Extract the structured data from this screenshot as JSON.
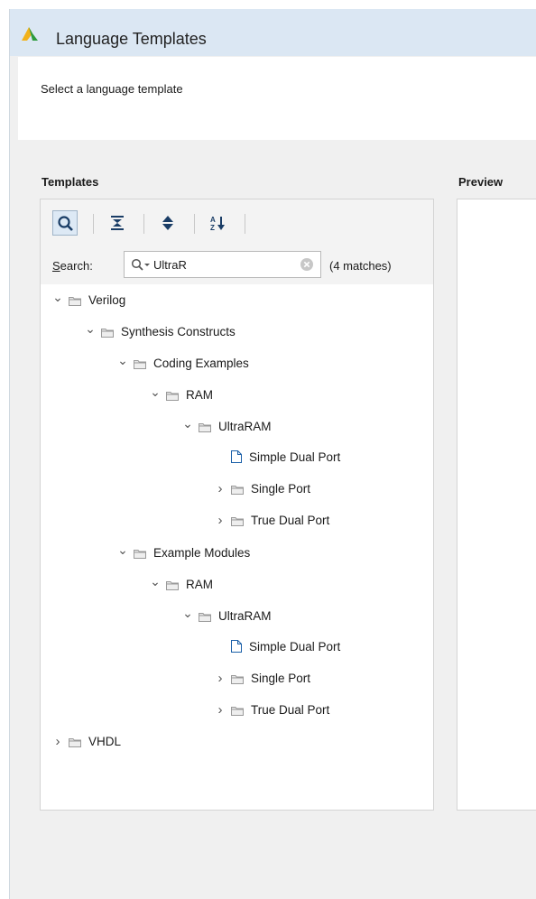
{
  "window": {
    "title": "Language Templates"
  },
  "header": {
    "subtitle": "Select a language template"
  },
  "templates": {
    "label": "Templates"
  },
  "preview": {
    "label": "Preview"
  },
  "toolbar": {
    "buttons": [
      "search-icon",
      "collapse-all-icon",
      "expand-icon",
      "sort-icon"
    ]
  },
  "search": {
    "label_prefix": "S",
    "label_rest": "earch:",
    "value": "UltraR",
    "match_count": "(4 matches)"
  },
  "tree": [
    {
      "label": "Verilog",
      "level": 0,
      "expanded": true,
      "type": "folder"
    },
    {
      "label": "Synthesis Constructs",
      "level": 1,
      "expanded": true,
      "type": "folder"
    },
    {
      "label": "Coding Examples",
      "level": 2,
      "expanded": true,
      "type": "folder"
    },
    {
      "label": "RAM",
      "level": 3,
      "expanded": true,
      "type": "folder"
    },
    {
      "label": "UltraRAM",
      "level": 4,
      "expanded": true,
      "type": "folder"
    },
    {
      "label": "Simple Dual Port",
      "level": 5,
      "type": "file"
    },
    {
      "label": "Single Port",
      "level": 5,
      "expanded": false,
      "type": "folder"
    },
    {
      "label": "True Dual Port",
      "level": 5,
      "expanded": false,
      "type": "folder"
    },
    {
      "label": "Example Modules",
      "level": 2,
      "expanded": true,
      "type": "folder"
    },
    {
      "label": "RAM",
      "level": 3,
      "expanded": true,
      "type": "folder"
    },
    {
      "label": "UltraRAM",
      "level": 4,
      "expanded": true,
      "type": "folder"
    },
    {
      "label": "Simple Dual Port",
      "level": 5,
      "type": "file"
    },
    {
      "label": "Single Port",
      "level": 5,
      "expanded": false,
      "type": "folder"
    },
    {
      "label": "True Dual Port",
      "level": 5,
      "expanded": false,
      "type": "folder"
    },
    {
      "label": "VHDL",
      "level": 0,
      "expanded": false,
      "type": "folder"
    }
  ],
  "colors": {
    "title_bar": "#dbe7f3",
    "panel_bg": "#f0f0f0",
    "accent": "#1a5fa8"
  }
}
